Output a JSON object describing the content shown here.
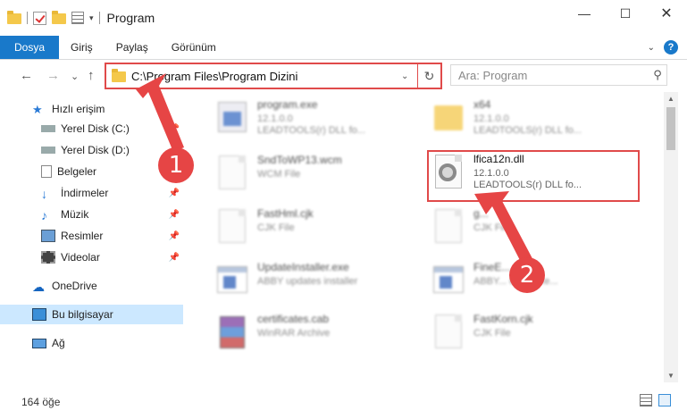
{
  "window": {
    "title": "Program",
    "minimize_glyph": "—",
    "maximize_glyph": "☐",
    "close_glyph": "✕"
  },
  "ribbon": {
    "tabs": [
      {
        "label": "Dosya",
        "active": true
      },
      {
        "label": "Giriş",
        "active": false
      },
      {
        "label": "Paylaş",
        "active": false
      },
      {
        "label": "Görünüm",
        "active": false
      }
    ],
    "help_glyph": "?"
  },
  "address": {
    "path": "C:\\Program Files\\Program Dizini",
    "refresh_glyph": "↻",
    "dropdown_glyph": "⌄"
  },
  "nav_buttons": {
    "back": "←",
    "forward": "→",
    "recent": "⌄",
    "up": "↑"
  },
  "search": {
    "placeholder": "Ara: Program",
    "icon": "search-icon"
  },
  "sidebar": {
    "items": [
      {
        "label": "Hızlı erişim",
        "icon": "star-icon",
        "pinned": false
      },
      {
        "label": "Yerel Disk (C:)",
        "icon": "drive-icon",
        "pinned": true
      },
      {
        "label": "Yerel Disk (D:)",
        "icon": "drive-icon",
        "pinned": true
      },
      {
        "label": "Belgeler",
        "icon": "documents-icon",
        "pinned": true
      },
      {
        "label": "İndirmeler",
        "icon": "download-icon",
        "pinned": true
      },
      {
        "label": "Müzik",
        "icon": "music-icon",
        "pinned": true
      },
      {
        "label": "Resimler",
        "icon": "pictures-icon",
        "pinned": true
      },
      {
        "label": "Videolar",
        "icon": "videos-icon",
        "pinned": true
      },
      {
        "label": "OneDrive",
        "icon": "cloud-icon",
        "pinned": false
      },
      {
        "label": "Bu bilgisayar",
        "icon": "computer-icon",
        "pinned": false,
        "selected": true
      },
      {
        "label": "Ağ",
        "icon": "network-icon",
        "pinned": false
      }
    ]
  },
  "files": [
    {
      "name": "program.exe",
      "line2": "12.1.0.0",
      "line3": "LEADTOOLS(r) DLL fo...",
      "icon": "exe-icon"
    },
    {
      "name": "x64",
      "line2": "12.1.0.0",
      "line3": "LEADTOOLS(r) DLL fo...",
      "icon": "folder-icon"
    },
    {
      "name": "SndToWP13.wcm",
      "line2": "WCM File",
      "line3": "",
      "icon": "file-icon"
    },
    {
      "name": "lfica12n.dll",
      "line2": "12.1.0.0",
      "line3": "LEADTOOLS(r) DLL fo...",
      "icon": "dll-gear-icon"
    },
    {
      "name": "FastHml.cjk",
      "line2": "CJK File",
      "line3": "",
      "icon": "file-icon"
    },
    {
      "name": "g...",
      "line2": "CJK File",
      "line3": "",
      "icon": "file-icon"
    },
    {
      "name": "UpdateInstaller.exe",
      "line2": "ABBY updates installer",
      "line3": "",
      "icon": "installer-icon"
    },
    {
      "name": "FineE...",
      "line2": "ABBY... ound exe...",
      "line3": "",
      "icon": "installer-icon"
    },
    {
      "name": "certificates.cab",
      "line2": "WinRAR Archive",
      "line3": "",
      "icon": "archive-icon"
    },
    {
      "name": "FastKorn.cjk",
      "line2": "CJK File",
      "line3": "",
      "icon": "file-icon"
    }
  ],
  "status": {
    "count_text": "164 öğe"
  },
  "annotations": {
    "step1": "1",
    "step2": "2",
    "color": "#e64545"
  }
}
